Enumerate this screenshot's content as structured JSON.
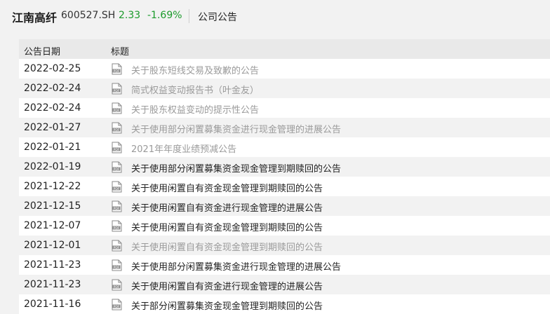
{
  "header": {
    "stock_name": "江南高纤",
    "stock_code": "600527.SH",
    "price": "2.33",
    "change": "-1.69%",
    "section_title": "公司公告"
  },
  "table": {
    "col_date": "公告日期",
    "col_title": "标题",
    "rows": [
      {
        "date": "2022-02-25",
        "title": "关于股东短线交易及致歉的公告",
        "visited": true
      },
      {
        "date": "2022-02-24",
        "title": "简式权益变动报告书（叶金友）",
        "visited": true
      },
      {
        "date": "2022-02-24",
        "title": "关于股东权益变动的提示性公告",
        "visited": true
      },
      {
        "date": "2022-01-27",
        "title": "关于使用部分闲置募集资金进行现金管理的进展公告",
        "visited": true
      },
      {
        "date": "2022-01-21",
        "title": "2021年年度业绩预减公告",
        "visited": true
      },
      {
        "date": "2022-01-19",
        "title": "关于使用部分闲置募集资金现金管理到期赎回的公告",
        "visited": false
      },
      {
        "date": "2021-12-22",
        "title": "关于使用闲置自有资金现金管理到期赎回的公告",
        "visited": false
      },
      {
        "date": "2021-12-15",
        "title": "关于使用闲置自有资金进行现金管理的进展公告",
        "visited": false
      },
      {
        "date": "2021-12-07",
        "title": "关于使用闲置自有资金现金管理到期赎回的公告",
        "visited": false
      },
      {
        "date": "2021-12-01",
        "title": "关于使用闲置自有资金现金管理到期赎回的公告",
        "visited": true
      },
      {
        "date": "2021-11-23",
        "title": "关于使用部分闲置募集资金进行现金管理的进展公告",
        "visited": false
      },
      {
        "date": "2021-11-23",
        "title": "关于使用闲置自有资金进行现金管理的进展公告",
        "visited": false
      },
      {
        "date": "2021-11-16",
        "title": "关于部分闲置募集资金现金管理到期赎回的公告",
        "visited": false
      }
    ]
  },
  "colors": {
    "price_down": "#1a9a2a",
    "visited_link": "#9a9a9a",
    "pdf_icon": "#8a8a8a"
  },
  "icons": {
    "row_icon": "pdf-file-icon"
  }
}
